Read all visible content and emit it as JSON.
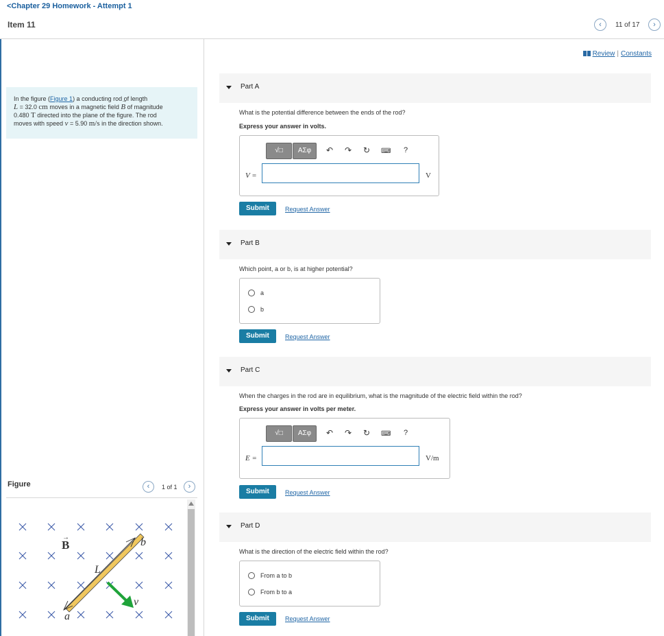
{
  "header": {
    "back_label": "<Chapter 29 Homework - Attempt 1",
    "item_title": "Item 11",
    "prev_icon": "chevron-left-icon",
    "next_icon": "chevron-right-icon",
    "counter": "11 of 17"
  },
  "problem": {
    "prefix": "In the figure (",
    "figure_link": "Figure 1",
    "l1_after": ") a conducting rod of length",
    "l2_var": "L",
    "l2_eq": " = 32.0 ",
    "l2_unit": "cm",
    "l2_mid": " moves in a magnetic field ",
    "l2_B": "B",
    "l2_end": " of magnitude",
    "l3_start": "0.480 ",
    "l3_unit": "T",
    "l3_end": " directed into the plane of the figure. The rod",
    "l4_start": "moves with speed ",
    "l4_var": "v",
    "l4_eq": " = 5.90 ",
    "l4_unit": "m/s",
    "l4_end": " in the direction shown."
  },
  "figure": {
    "title": "Figure",
    "counter": "1 of 1",
    "label_B": "B",
    "label_L": "L",
    "label_a": "a",
    "label_b": "b",
    "label_v": "v"
  },
  "links": {
    "review": "Review",
    "separator": "|",
    "constants": "Constants"
  },
  "toolbar": {
    "template_label": "√□",
    "symbols_label": "ΑΣφ",
    "undo_icon": "undo-icon",
    "redo_icon": "redo-icon",
    "reset_icon": "reset-icon",
    "keyboard_icon": "keyboard-icon",
    "help_label": "?"
  },
  "parts": [
    {
      "label": "Part A",
      "question": "What is the potential difference between the ends of the rod?",
      "instruction": "Express your answer in volts.",
      "var_label": "V =",
      "value": "",
      "unit": "V",
      "submit": "Submit",
      "request": "Request Answer"
    },
    {
      "label": "Part B",
      "question": "Which point, a or b, is at higher potential?",
      "options": [
        "a",
        "b"
      ],
      "submit": "Submit",
      "request": "Request Answer"
    },
    {
      "label": "Part C",
      "question": "When the charges in the rod are in equilibrium, what is the magnitude of the electric field within the rod?",
      "instruction": "Express your answer in volts per meter.",
      "var_label": "E =",
      "value": "",
      "unit": "V/m",
      "submit": "Submit",
      "request": "Request Answer"
    },
    {
      "label": "Part D",
      "question": "What is the direction of the electric field within the rod?",
      "options": [
        "From a to b",
        "From b to a"
      ],
      "submit": "Submit",
      "request": "Request Answer"
    }
  ],
  "colors": {
    "accent": "#1a7da4",
    "link": "#2166a6",
    "problem_bg": "#e6f4f7",
    "rod": "#f0c75e",
    "velocity_arrow": "#1fa33a",
    "field_x": "#3b5aa8"
  }
}
